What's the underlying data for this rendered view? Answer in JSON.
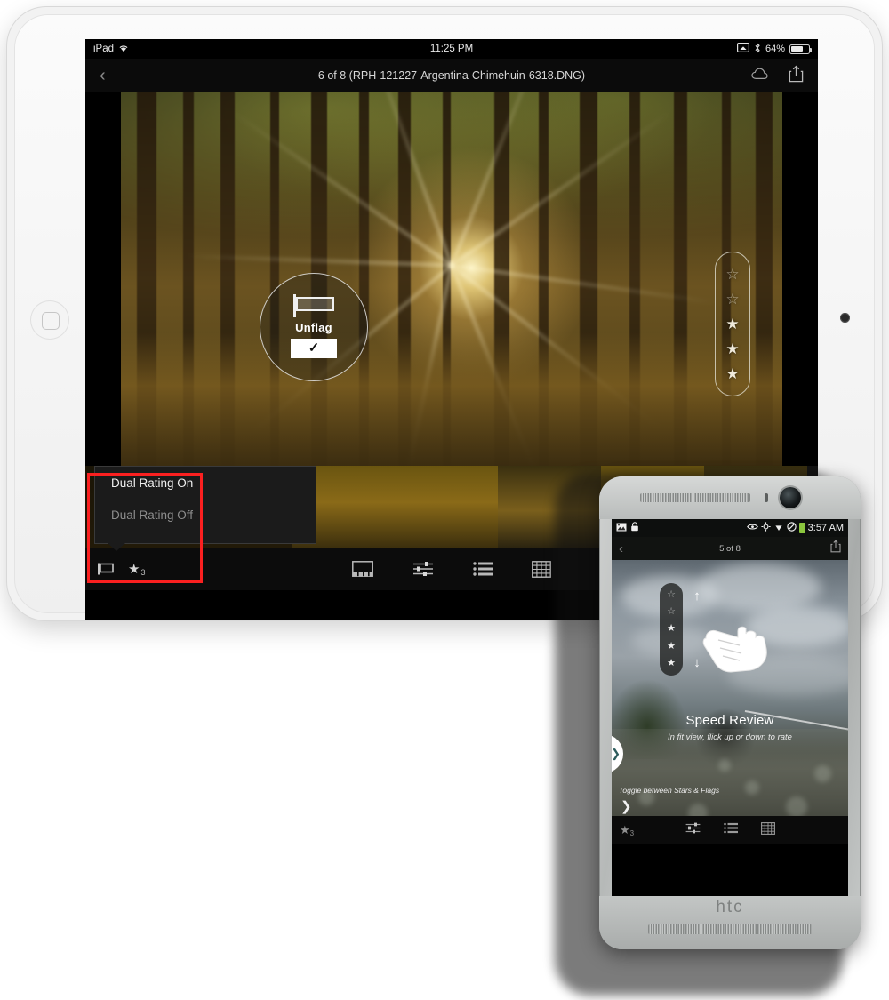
{
  "ipad": {
    "status_bar": {
      "device": "iPad",
      "wifi_icon": "wifi-icon",
      "time": "11:25 PM",
      "airplay_icon": "screen-mirroring-icon",
      "bluetooth_icon": "bluetooth-icon",
      "battery_percent": "64%"
    },
    "nav_bar": {
      "back_icon": "chevron-left-icon",
      "title": "6 of 8 (RPH-121227-Argentina-Chimehuin-6318.DNG)",
      "cloud_icon": "cloud-icon",
      "share_icon": "share-icon"
    },
    "overlay": {
      "flag_icon": "flag-outline-icon",
      "label": "Unflag",
      "check_icon": "checkmark-icon"
    },
    "star_capsule": {
      "name": "star-rating-capsule",
      "total": 5,
      "filled": 3,
      "star_glyph": "★",
      "hollow_glyph": "☆"
    },
    "popup": {
      "option_on": "Dual Rating On",
      "option_off": "Dual Rating Off",
      "highlight_color": "#fb2020"
    },
    "toolbar": {
      "flag_icon": "flag-icon",
      "star_icon": "★",
      "star_count": "3",
      "items": [
        {
          "name": "filmstrip-view-icon",
          "label": "filmstrip"
        },
        {
          "name": "adjust-sliders-icon",
          "label": "adjust"
        },
        {
          "name": "list-view-icon",
          "label": "list"
        },
        {
          "name": "grid-view-icon",
          "label": "grid"
        }
      ]
    }
  },
  "phone": {
    "brand": "htc",
    "status_bar": {
      "photo_icon": "image-icon",
      "lock_icon": "lock-icon",
      "eye_icon": "eye-icon",
      "gps_icon": "location-icon",
      "wifi_icon": "wifi-icon",
      "silent_icon": "mute-icon",
      "battery_icon": "battery-icon",
      "time": "3:57 AM"
    },
    "nav_bar": {
      "back_icon": "chevron-left-icon",
      "title": "5 of 8",
      "share_icon": "share-icon"
    },
    "edge_tab_icon": "chevron-right-icon",
    "star_strip": {
      "name": "star-rating-strip",
      "total": 5,
      "filled": 3,
      "star_glyph": "★",
      "hollow_glyph": "☆"
    },
    "gesture": {
      "up_arrow": "↑",
      "down_arrow": "↓",
      "hand_icon": "hand-cursor-icon"
    },
    "coach": {
      "title": "Speed Review",
      "subtitle": "In fit view, flick up or down to rate",
      "hint": "Toggle between Stars & Flags",
      "chevron": "❯"
    },
    "toolbar": {
      "star_icon": "★",
      "star_count": "3",
      "items": [
        {
          "name": "adjust-sliders-icon",
          "label": "adjust"
        },
        {
          "name": "list-view-icon",
          "label": "list"
        },
        {
          "name": "grid-view-icon",
          "label": "grid"
        }
      ]
    }
  }
}
